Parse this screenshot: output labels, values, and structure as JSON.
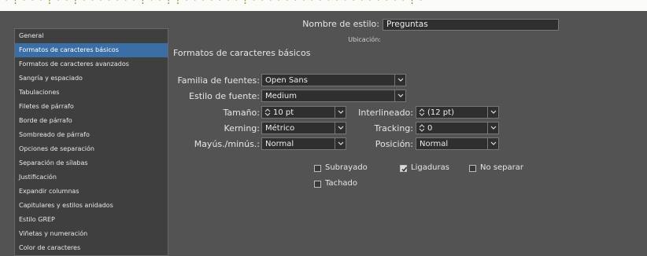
{
  "banner_text": "· ! · · · ! · · ! · · · · · · · ! · · ! ! · · · · · · · ! · · · · · · · · · · · · · · · · · · · ! ·",
  "sidebar": {
    "items": [
      {
        "label": "General"
      },
      {
        "label": "Formatos de caracteres básicos"
      },
      {
        "label": "Formatos de caracteres avanzados"
      },
      {
        "label": "Sangría y espaciado"
      },
      {
        "label": "Tabulaciones"
      },
      {
        "label": "Filetes de párrafo"
      },
      {
        "label": "Borde de párrafo"
      },
      {
        "label": "Sombreado de párrafo"
      },
      {
        "label": "Opciones de separación"
      },
      {
        "label": "Separación de sílabas"
      },
      {
        "label": "Justificación"
      },
      {
        "label": "Expandir columnas"
      },
      {
        "label": "Capitulares y estilos anidados"
      },
      {
        "label": "Estilo GREP"
      },
      {
        "label": "Viñetas y numeración"
      },
      {
        "label": "Color de caracteres"
      }
    ],
    "selected_index": 1
  },
  "style_name": {
    "label": "Nombre de estilo:",
    "value": "Preguntas"
  },
  "location": {
    "label": "Ubicación:"
  },
  "section": {
    "title": "Formatos de caracteres básicos"
  },
  "font_family": {
    "label": "Familia de fuentes:",
    "value": "Open Sans"
  },
  "font_style": {
    "label": "Estilo de fuente:",
    "value": "Medium"
  },
  "size": {
    "label": "Tamaño:",
    "value": "10 pt"
  },
  "leading": {
    "label": "Interlineado:",
    "value": "(12 pt)"
  },
  "kerning": {
    "label": "Kerning:",
    "value": "Métrico"
  },
  "tracking": {
    "label": "Tracking:",
    "value": "0"
  },
  "case": {
    "label": "Mayús./minús.:",
    "value": "Normal"
  },
  "position": {
    "label": "Posición:",
    "value": "Normal"
  },
  "checkboxes": {
    "underline": {
      "label": "Subrayado",
      "checked": false
    },
    "ligatures": {
      "label": "Ligaduras",
      "checked": true
    },
    "no_break": {
      "label": "No separar",
      "checked": false
    },
    "strikethrough": {
      "label": "Tachado",
      "checked": false
    }
  },
  "colors": {
    "selected_row": "#3a6ea5",
    "background": "#535353",
    "field": "#2f2f2f"
  }
}
